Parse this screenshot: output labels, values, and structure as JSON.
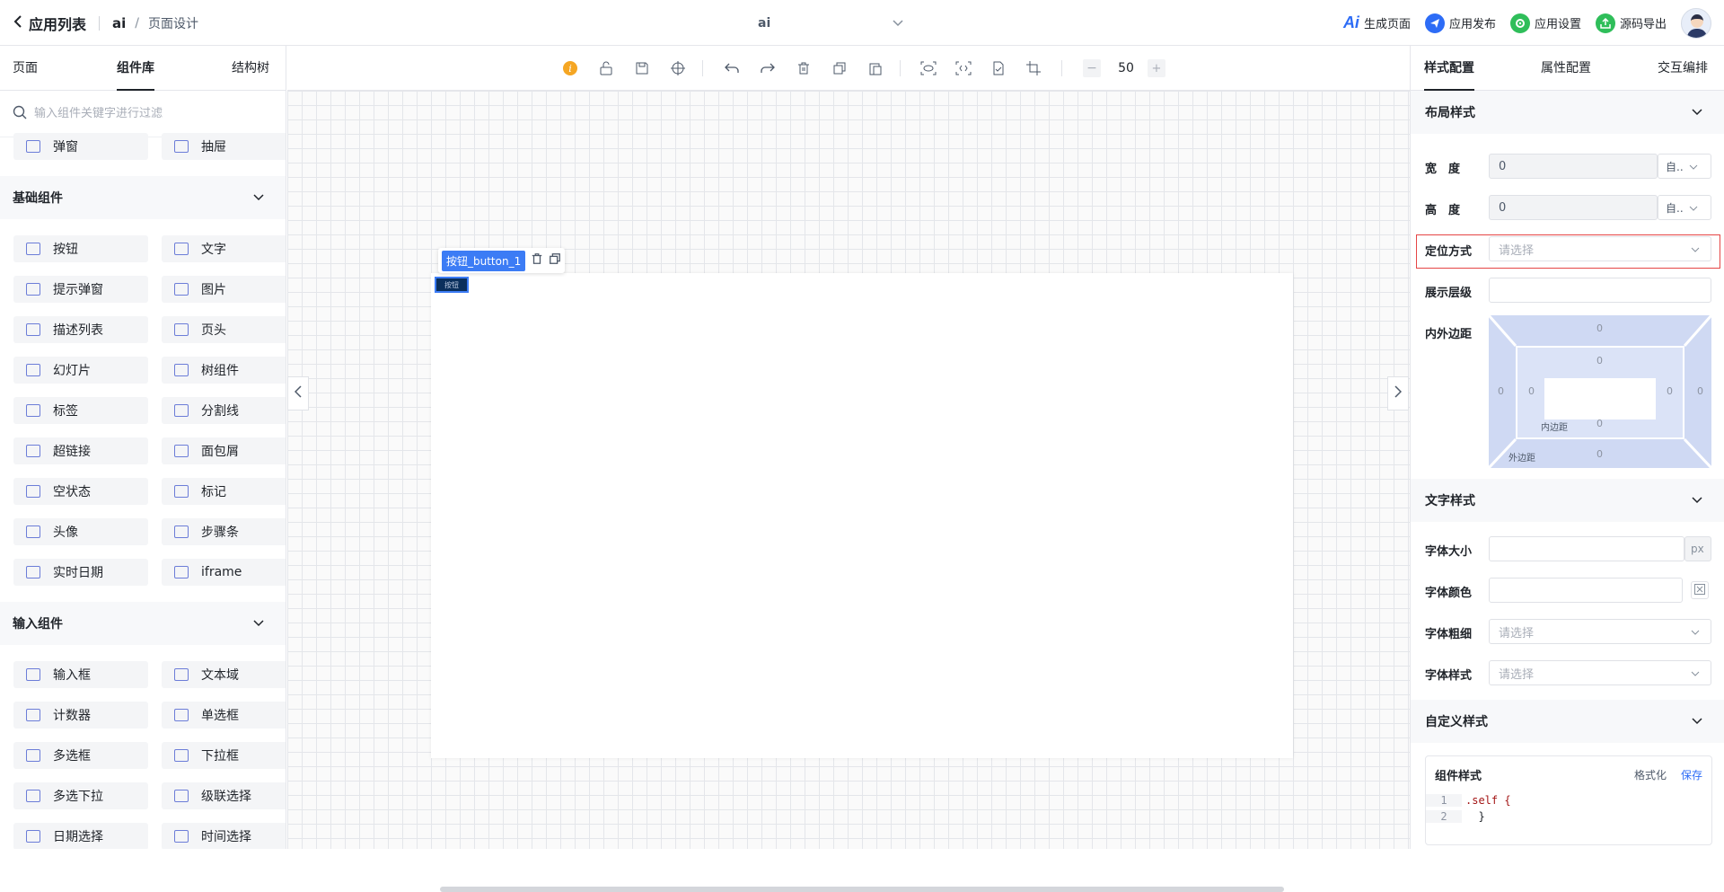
{
  "header": {
    "back_label": "应用列表",
    "app_short": "ai",
    "breadcrumb_sep": "/",
    "page_title": "页面设计",
    "center_app": "ai",
    "actions": [
      {
        "label": "生成页面",
        "icon": "ai-icon",
        "color": "#2d6cf6"
      },
      {
        "label": "应用发布",
        "icon": "send-icon",
        "color": "#2d6cf6"
      },
      {
        "label": "应用设置",
        "icon": "gear-icon",
        "color": "#2fbe5a"
      },
      {
        "label": "源码导出",
        "icon": "export-icon",
        "color": "#2fbe5a"
      }
    ]
  },
  "left": {
    "tabs": [
      "页面",
      "组件库",
      "结构树"
    ],
    "active_tab": "组件库",
    "search_placeholder": "输入组件关键字进行过滤",
    "top_items": [
      "弹窗",
      "抽屉"
    ],
    "sections": [
      {
        "title": "基础组件",
        "items": [
          "按钮",
          "文字",
          "提示弹窗",
          "图片",
          "描述列表",
          "页头",
          "幻灯片",
          "树组件",
          "标签",
          "分割线",
          "超链接",
          "面包屑",
          "空状态",
          "标记",
          "头像",
          "步骤条",
          "实时日期",
          "iframe"
        ]
      },
      {
        "title": "输入组件",
        "items": [
          "输入框",
          "文本域",
          "计数器",
          "单选框",
          "多选框",
          "下拉框",
          "多选下拉",
          "级联选择",
          "日期选择",
          "时间选择"
        ]
      }
    ]
  },
  "canvas": {
    "zoom": "50",
    "zoom_minus": "−",
    "zoom_plus": "+",
    "selected_label": "按钮_button_1",
    "selected_button_text": "按钮"
  },
  "right": {
    "tabs": [
      "样式配置",
      "属性配置",
      "交互编排"
    ],
    "active_tab": "样式配置",
    "layout_section": "布局样式",
    "width_label": "宽　度",
    "width_value": "0",
    "width_unit": "自..",
    "height_label": "高　度",
    "height_value": "0",
    "height_unit": "自..",
    "position_label": "定位方式",
    "position_placeholder": "请选择",
    "zindex_label": "展示层级",
    "spacing_label": "内外边距",
    "margin_values": {
      "top": "0",
      "left": "0",
      "right": "0",
      "bottom": "0"
    },
    "padding_values": {
      "top": "0",
      "left": "0",
      "right": "0",
      "bottom": "0"
    },
    "padding_text": "内边距",
    "margin_text": "外边距",
    "text_section": "文字样式",
    "font_size_label": "字体大小",
    "font_size_unit": "px",
    "font_color_label": "字体颜色",
    "font_weight_label": "字体粗细",
    "font_weight_placeholder": "请选择",
    "font_style_label": "字体样式",
    "font_style_placeholder": "请选择",
    "custom_section": "自定义样式",
    "code_title": "组件样式",
    "code_format": "格式化",
    "code_save": "保存",
    "code_lines": [
      ".self {",
      "  }"
    ]
  }
}
